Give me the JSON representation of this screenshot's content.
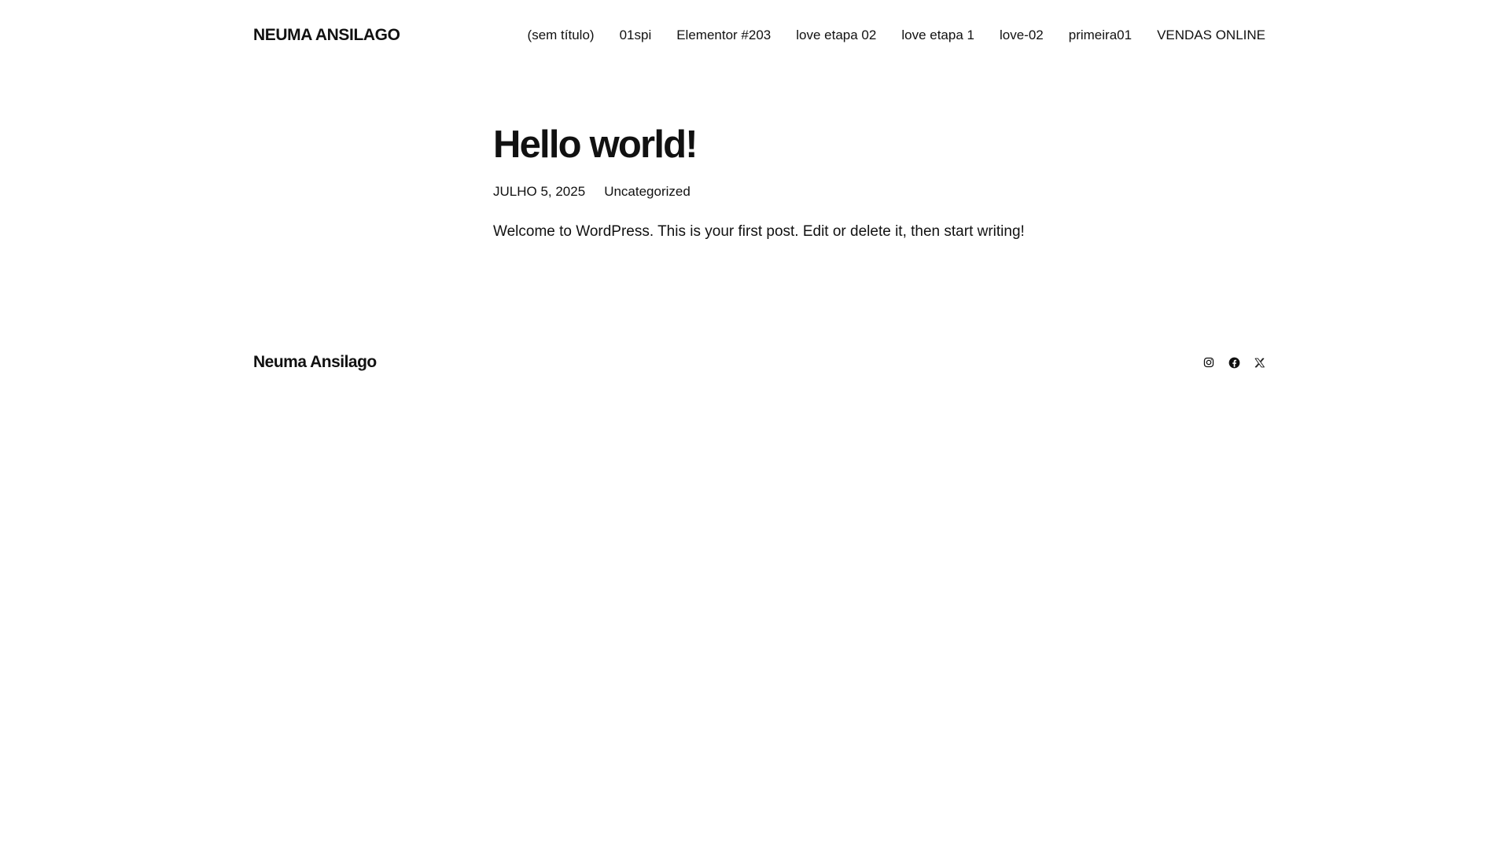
{
  "header": {
    "site_title": "NEUMA ANSILAGO",
    "nav": [
      {
        "label": "(sem título)"
      },
      {
        "label": "01spi"
      },
      {
        "label": "Elementor #203"
      },
      {
        "label": "love etapa 02"
      },
      {
        "label": "love etapa 1"
      },
      {
        "label": "love-02"
      },
      {
        "label": "primeira01"
      },
      {
        "label": "VENDAS ONLINE"
      }
    ]
  },
  "post": {
    "title": "Hello world!",
    "date": "JULHO 5, 2025",
    "category": "Uncategorized",
    "excerpt": "Welcome to WordPress. This is your first post. Edit or delete it, then start writing!"
  },
  "footer": {
    "site_title": "Neuma Ansilago",
    "social": [
      {
        "icon": "instagram-icon"
      },
      {
        "icon": "facebook-icon"
      },
      {
        "icon": "x-icon"
      }
    ]
  },
  "colors": {
    "text": "#111111",
    "background": "#ffffff"
  }
}
